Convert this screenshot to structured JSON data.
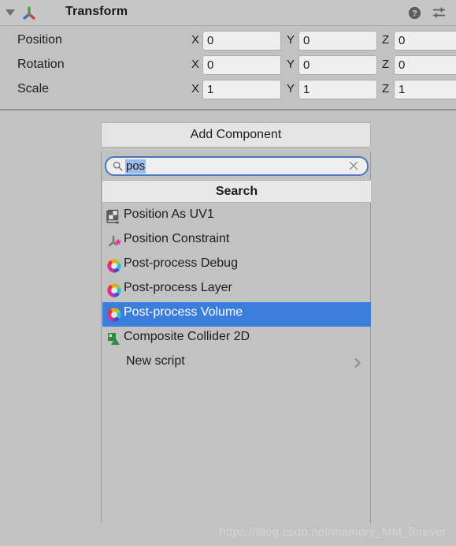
{
  "component": {
    "title": "Transform",
    "foldout_icon": "triangle-down-icon",
    "gizmo_icon": "transform-axis-icon",
    "help_icon": "help-icon",
    "preset_icon": "preset-settings-icon",
    "rows": [
      {
        "label": "Position",
        "axes": [
          {
            "axis": "X",
            "value": "0"
          },
          {
            "axis": "Y",
            "value": "0"
          },
          {
            "axis": "Z",
            "value": "0"
          }
        ]
      },
      {
        "label": "Rotation",
        "axes": [
          {
            "axis": "X",
            "value": "0"
          },
          {
            "axis": "Y",
            "value": "0"
          },
          {
            "axis": "Z",
            "value": "0"
          }
        ]
      },
      {
        "label": "Scale",
        "axes": [
          {
            "axis": "X",
            "value": "1"
          },
          {
            "axis": "Y",
            "value": "1"
          },
          {
            "axis": "Z",
            "value": "1"
          }
        ]
      }
    ]
  },
  "add_component": {
    "label": "Add Component"
  },
  "dropdown": {
    "search": {
      "value": "pos",
      "placeholder": "Search",
      "magnifier_icon": "search-icon",
      "clear_icon": "close-icon",
      "selection_color": "#9dbbe8",
      "focus_border_color": "#4a78c0"
    },
    "header_label": "Search",
    "selection_color": "#3a7ddb",
    "items": [
      {
        "label": "Position As UV1",
        "icon": "position-as-uv1-icon",
        "selected": false,
        "has_submenu": false
      },
      {
        "label": "Position Constraint",
        "icon": "position-constraint-icon",
        "selected": false,
        "has_submenu": false
      },
      {
        "label": "Post-process Debug",
        "icon": "post-process-icon",
        "selected": false,
        "has_submenu": false
      },
      {
        "label": "Post-process Layer",
        "icon": "post-process-icon",
        "selected": false,
        "has_submenu": false
      },
      {
        "label": "Post-process Volume",
        "icon": "post-process-icon",
        "selected": true,
        "has_submenu": false
      },
      {
        "label": "Composite Collider 2D",
        "icon": "composite-collider-2d-icon",
        "selected": false,
        "has_submenu": false
      },
      {
        "label": "New script",
        "icon": "none",
        "selected": false,
        "has_submenu": true
      }
    ]
  },
  "watermark": {
    "text": "https://blog.csdn.net/memory_MM_forever"
  }
}
